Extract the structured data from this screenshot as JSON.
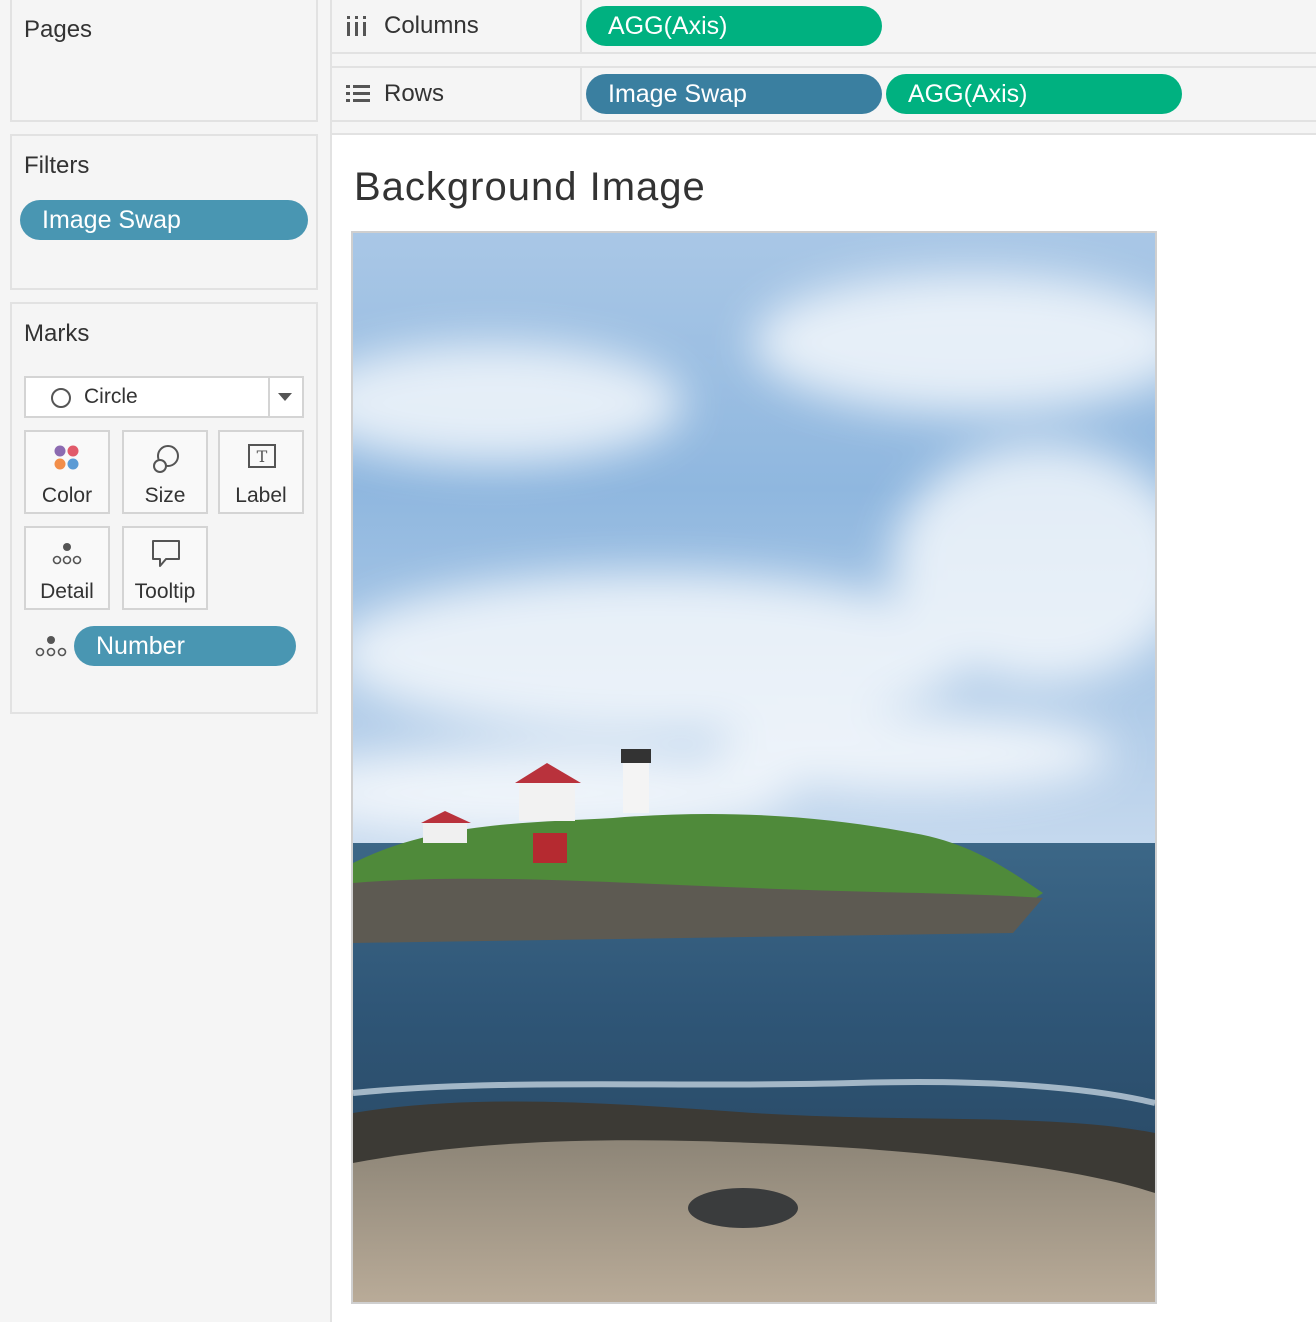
{
  "pages": {
    "title": "Pages"
  },
  "filters": {
    "title": "Filters",
    "pills": [
      "Image Swap"
    ]
  },
  "marks": {
    "title": "Marks",
    "mark_type": "Circle",
    "buttons": {
      "color": "Color",
      "size": "Size",
      "label": "Label",
      "detail": "Detail",
      "tooltip": "Tooltip"
    },
    "detail_pill": "Number"
  },
  "shelves": {
    "columns": {
      "label": "Columns",
      "pills": [
        "AGG(Axis)"
      ]
    },
    "rows": {
      "label": "Rows",
      "pills": [
        "Image Swap",
        "AGG(Axis)"
      ]
    }
  },
  "viz": {
    "title": "Background Image"
  },
  "colors": {
    "dimension_pill": "#4996b2",
    "measure_pill": "#00b180"
  }
}
